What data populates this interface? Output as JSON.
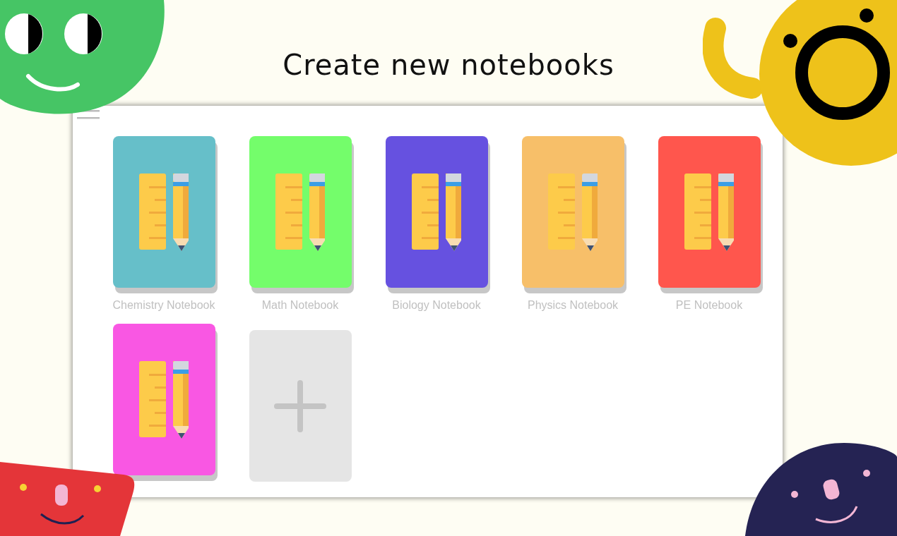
{
  "title": "Create new notebooks",
  "notebooks": [
    {
      "kind": "notebook",
      "label": "Chemistry Notebook",
      "color": "#66bfc9"
    },
    {
      "kind": "notebook",
      "label": "Math Notebook",
      "color": "#74fd6b"
    },
    {
      "kind": "notebook",
      "label": "Biology Notebook",
      "color": "#6651e0"
    },
    {
      "kind": "notebook",
      "label": "Physics Notebook",
      "color": "#f7bf69"
    },
    {
      "kind": "notebook",
      "label": "PE Notebook",
      "color": "#ff564d"
    },
    {
      "kind": "notebook",
      "color": "#f957e3"
    },
    {
      "kind": "add"
    }
  ]
}
